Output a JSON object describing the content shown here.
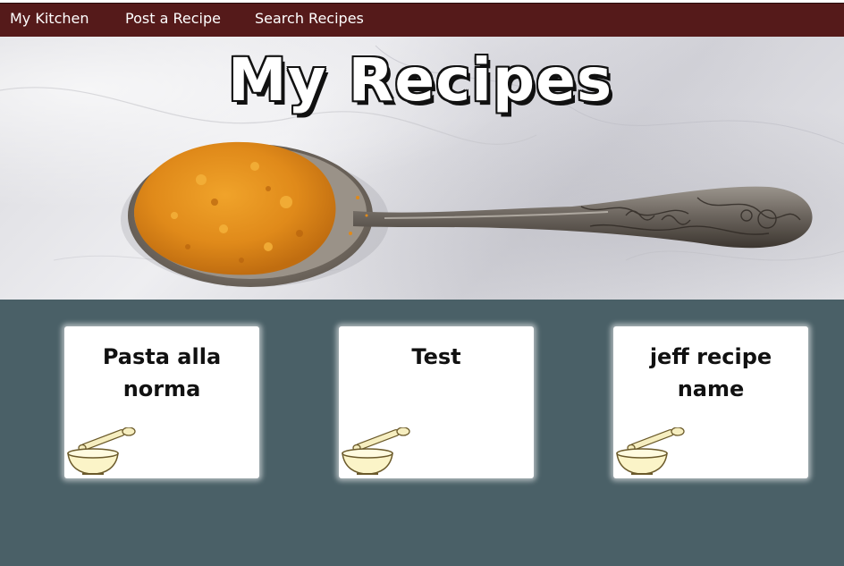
{
  "nav": {
    "items": [
      {
        "label": "My Kitchen"
      },
      {
        "label": "Post a Recipe"
      },
      {
        "label": "Search Recipes"
      }
    ]
  },
  "hero": {
    "title": "My Recipes"
  },
  "recipes": [
    {
      "title": "Pasta alla norma",
      "icon": "mortar-pestle-icon"
    },
    {
      "title": "Test",
      "icon": "mortar-pestle-icon"
    },
    {
      "title": "jeff recipe name",
      "icon": "mortar-pestle-icon"
    }
  ],
  "colors": {
    "nav_bg": "#551a1a",
    "page_bg": "#4a6067",
    "card_bg": "#ffffff",
    "spice": "#e08a1a"
  }
}
